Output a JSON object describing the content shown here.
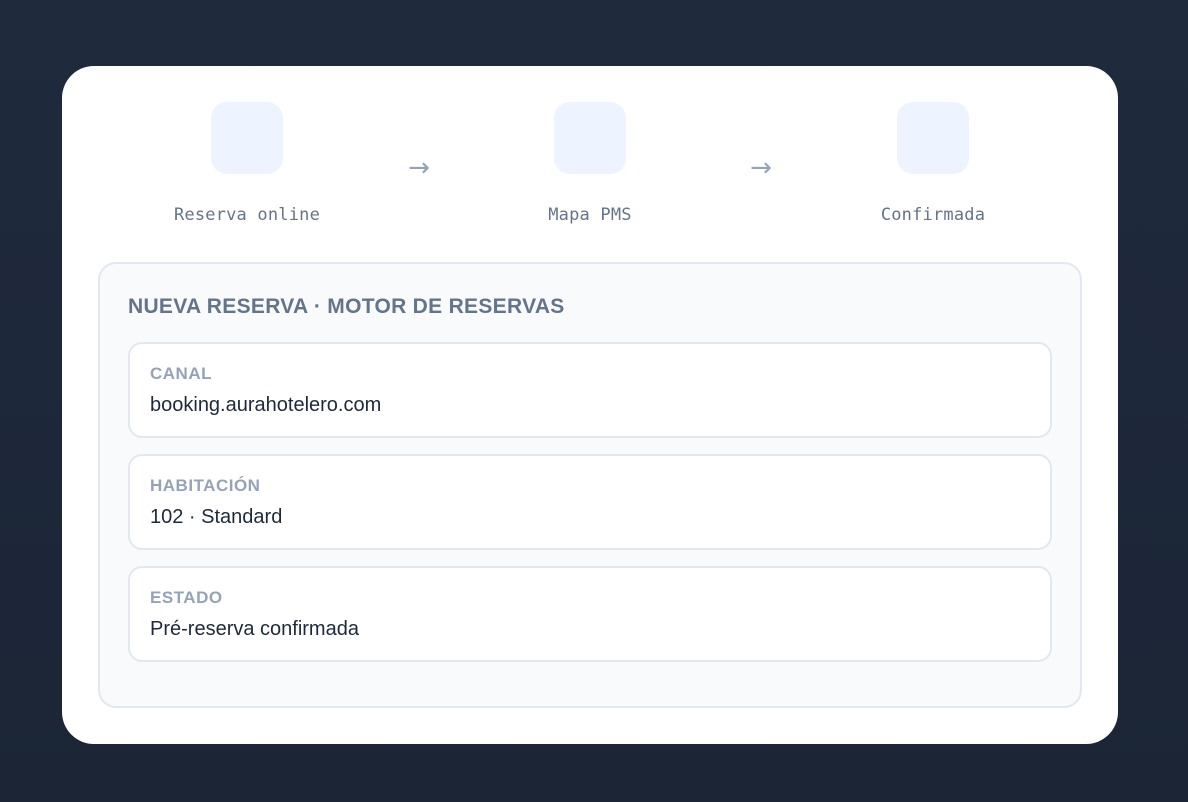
{
  "steps": [
    {
      "label": "Reserva online",
      "icon": "step-icon"
    },
    {
      "label": "Mapa PMS",
      "icon": "step-icon"
    },
    {
      "label": "Confirmada",
      "icon": "step-icon"
    }
  ],
  "arrow_glyph": "→",
  "panel": {
    "title": "NUEVA RESERVA · MOTOR DE RESERVAS",
    "fields": [
      {
        "label": "CANAL",
        "value": "booking.aurahotelero.com"
      },
      {
        "label": "HABITACIÓN",
        "value": "102 · Standard"
      },
      {
        "label": "ESTADO",
        "value": "Pré-reserva confirmada"
      }
    ]
  },
  "colors": {
    "background": "#1f2a3d",
    "card": "#ffffff",
    "step_box": "#edf4ff",
    "muted_text": "#64748b",
    "label_text": "#94a3b8",
    "value_text": "#1e293b",
    "border": "#e2e8f0"
  }
}
